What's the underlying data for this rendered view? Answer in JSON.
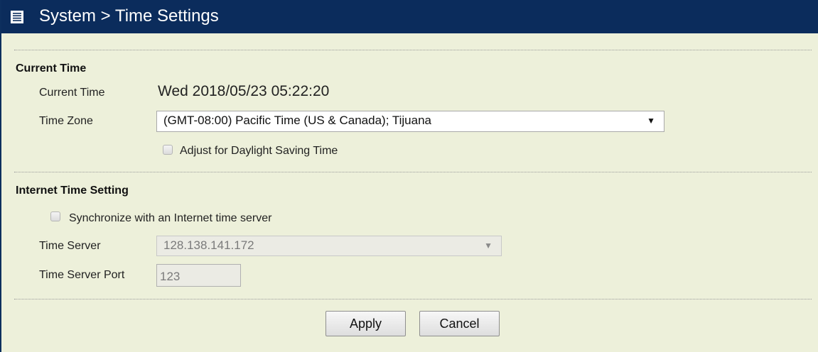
{
  "header": {
    "title": "System > Time Settings",
    "icon": "menu-list-icon"
  },
  "current_time_section": {
    "title": "Current Time",
    "current_time_label": "Current Time",
    "current_time_value": "Wed 2018/05/23 05:22:20",
    "time_zone_label": "Time Zone",
    "time_zone_value": "(GMT-08:00) Pacific Time (US & Canada); Tijuana",
    "dst_label": "Adjust for Daylight Saving Time",
    "dst_checked": false
  },
  "internet_time_section": {
    "title": "Internet Time Setting",
    "sync_label": "Synchronize with an Internet time server",
    "sync_checked": false,
    "time_server_label": "Time Server",
    "time_server_value": "128.138.141.172",
    "port_label": "Time Server Port",
    "port_value": "123"
  },
  "actions": {
    "apply_label": "Apply",
    "cancel_label": "Cancel"
  },
  "colors": {
    "header_bg": "#0b2c5c",
    "panel_bg": "#edf0da",
    "disabled_bg": "#ebebe4"
  }
}
